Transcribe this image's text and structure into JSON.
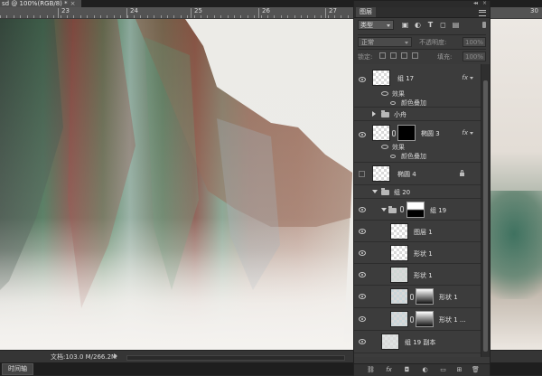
{
  "document_tab": {
    "title": "sd @ 100%(RGB/8) *",
    "close": "×"
  },
  "ruler": {
    "labels": [
      "23",
      "24",
      "25",
      "26",
      "27",
      "28",
      "29"
    ],
    "right_label": "30"
  },
  "status": {
    "doc_info": "文档:103.0 M/266.2M"
  },
  "timeline_tab": "时间轴",
  "layers_panel": {
    "title": "图层",
    "collapse_glyph": "◂◂",
    "close_glyph": "×",
    "filter": {
      "kind": "类型"
    },
    "blend_mode": "正常",
    "opacity_label": "不透明度:",
    "opacity_value": "100%",
    "lock_label": "锁定:",
    "fill_label": "填充:",
    "fill_value": "100%",
    "layers": [
      {
        "name": "组 17",
        "fx": "fx",
        "effects_label": "效果",
        "effect": "颜色叠加"
      },
      {
        "name": "小舟"
      },
      {
        "name": "椭圆 3",
        "fx": "fx",
        "effects_label": "效果",
        "effect": "颜色叠加"
      },
      {
        "name": "椭圆 4"
      },
      {
        "name": "组 20"
      },
      {
        "name": "组 19"
      },
      {
        "name": "图层 1"
      },
      {
        "name": "形状 1"
      },
      {
        "name": "形状 1"
      },
      {
        "name": "形状 1"
      },
      {
        "name": "形状 1 ..."
      },
      {
        "name": "组 19 副本"
      }
    ],
    "footer_icons": [
      "link-layers",
      "fx",
      "add-mask",
      "adjustment",
      "new-group",
      "new-layer",
      "delete"
    ]
  }
}
